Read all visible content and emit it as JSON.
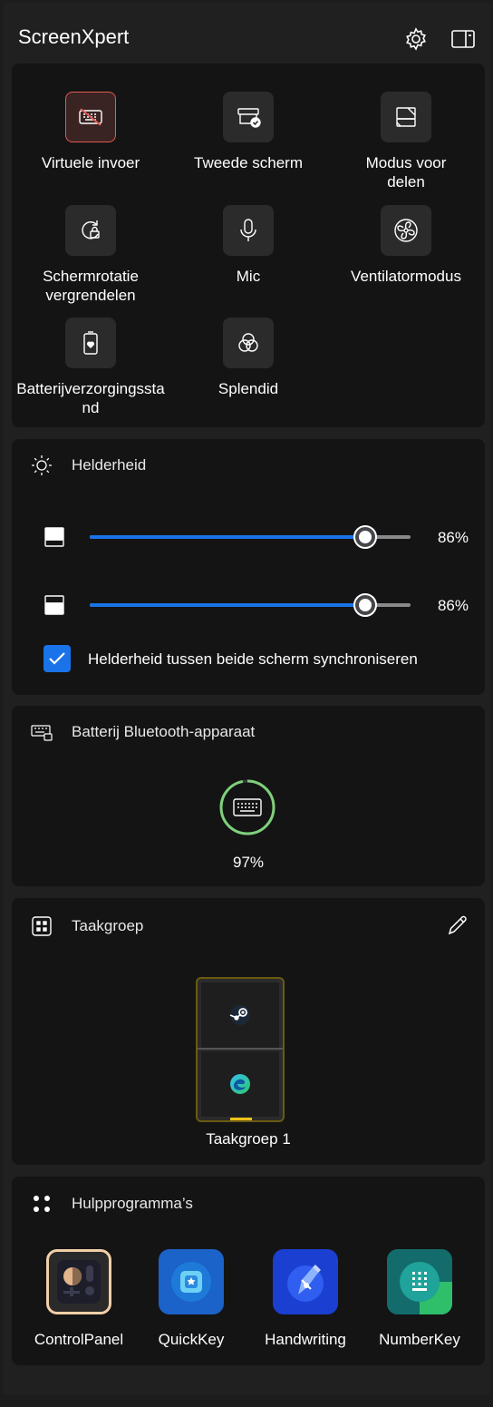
{
  "app": {
    "title": "ScreenXpert"
  },
  "quick_settings": {
    "tiles": [
      {
        "label": "Virtuele invoer",
        "icon": "keyboard-off-icon",
        "active": true
      },
      {
        "label": "Tweede scherm",
        "icon": "second-screen-icon",
        "active": false
      },
      {
        "label": "Modus voor delen",
        "icon": "share-mode-icon",
        "active": false
      },
      {
        "label": "Schermrotatie vergrendelen",
        "icon": "rotation-lock-icon",
        "active": false
      },
      {
        "label": "Mic",
        "icon": "microphone-icon",
        "active": false
      },
      {
        "label": "Ventilatormodus",
        "icon": "fan-icon",
        "active": false
      },
      {
        "label": "Batterijverzorgingsstand",
        "icon": "battery-care-icon",
        "active": false
      },
      {
        "label": "Splendid",
        "icon": "splendid-icon",
        "active": false
      }
    ]
  },
  "brightness": {
    "title": "Helderheid",
    "sliders": [
      {
        "display": "top-screen",
        "value": 86,
        "label": "86%"
      },
      {
        "display": "bottom-screen",
        "value": 86,
        "label": "86%"
      }
    ],
    "sync_checked": true,
    "sync_label": "Helderheid tussen beide scherm synchroniseren"
  },
  "bluetooth_battery": {
    "title": "Batterij Bluetooth-apparaat",
    "device_icon": "keyboard-icon",
    "level": 97,
    "label": "97%"
  },
  "task_group": {
    "title": "Taakgroep",
    "groups": [
      {
        "name": "Taakgroep 1",
        "apps": [
          "steam-icon",
          "edge-icon"
        ]
      }
    ]
  },
  "utilities": {
    "title": "Hulpprogramma’s",
    "apps": [
      {
        "label": "ControlPanel",
        "icon": "controlpanel-icon"
      },
      {
        "label": "QuickKey",
        "icon": "quickkey-icon"
      },
      {
        "label": "Handwriting",
        "icon": "handwriting-icon"
      },
      {
        "label": "NumberKey",
        "icon": "numberkey-icon"
      }
    ]
  },
  "colors": {
    "accent": "#1a73e8",
    "active_tile_border": "#e25a53",
    "battery_ring": "#7ed07a",
    "task_card_border": "#6b5a12"
  }
}
